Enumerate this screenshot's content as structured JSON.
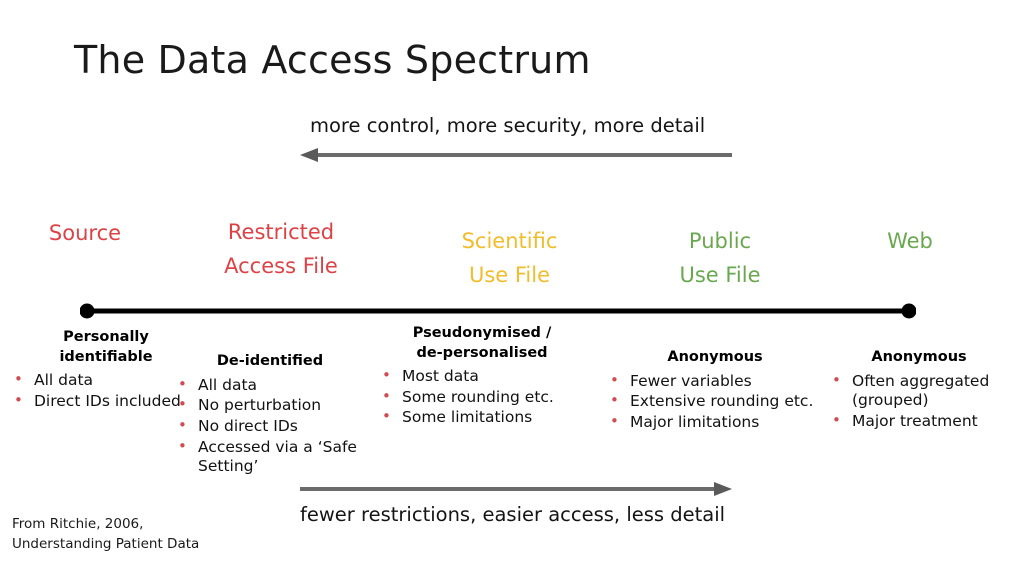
{
  "slide": {
    "title": "The Data Access Spectrum",
    "background_color": "#ffffff"
  },
  "captions": {
    "top": "more control, more security, more detail",
    "bottom": "fewer restrictions, easier access, less detail"
  },
  "arrows": {
    "top": {
      "direction": "left",
      "color": "#6b6b6b"
    },
    "bottom": {
      "direction": "right",
      "color": "#6b6b6b"
    }
  },
  "spectrum": {
    "line_color": "#000000",
    "endpoint_marker": "dot",
    "categories": [
      {
        "id": "source",
        "label_line1": "Source",
        "label_line2": "",
        "color": "#dd4246"
      },
      {
        "id": "restricted-access-file",
        "label_line1": "Restricted",
        "label_line2": "Access File",
        "color": "#dd4246"
      },
      {
        "id": "scientific-use-file",
        "label_line1": "Scientific",
        "label_line2": "Use File",
        "color": "#f2bc2b"
      },
      {
        "id": "public-use-file",
        "label_line1": "Public",
        "label_line2": "Use File",
        "color": "#6aa84f"
      },
      {
        "id": "web",
        "label_line1": "Web",
        "label_line2": "",
        "color": "#6aa84f"
      }
    ]
  },
  "columns": [
    {
      "id": "personally-identifiable",
      "heading_line1": "Personally",
      "heading_line2": "identifiable",
      "bullets": [
        "All data",
        "Direct IDs included"
      ]
    },
    {
      "id": "de-identified",
      "heading_line1": "De-identified",
      "heading_line2": "",
      "bullets": [
        "All data",
        "No perturbation",
        "No direct IDs",
        "Accessed via a ‘Safe Setting’"
      ]
    },
    {
      "id": "pseudonymised",
      "heading_line1": "Pseudonymised /",
      "heading_line2": "de-personalised",
      "bullets": [
        "Most data",
        "Some rounding etc.",
        "Some limitations"
      ]
    },
    {
      "id": "anonymous-fewer-variables",
      "heading_line1": "Anonymous",
      "heading_line2": "",
      "bullets": [
        "Fewer variables",
        "Extensive rounding etc.",
        "Major limitations"
      ]
    },
    {
      "id": "anonymous-aggregated",
      "heading_line1": "Anonymous",
      "heading_line2": "",
      "bullets": [
        "Often aggregated (grouped)",
        "Major treatment"
      ]
    }
  ],
  "source_note": {
    "line1": "From Ritchie, 2006,",
    "line2": "Understanding Patient Data"
  },
  "bullet_color": "#d24a53"
}
